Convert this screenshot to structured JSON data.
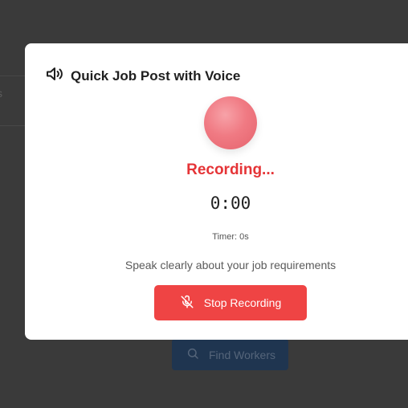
{
  "background": {
    "find_button_label": "Find Workers",
    "tab_fragment": "s"
  },
  "modal": {
    "title": "Quick Job Post with Voice",
    "title_icon": "speaker-icon",
    "recording_indicator": "pulsing-red-orb",
    "status": "Recording...",
    "timer_display": "0:00",
    "timer_label": "Timer: 0s",
    "hint": "Speak clearly about your job requirements",
    "stop_button_label": "Stop Recording",
    "stop_button_icon": "mic-off-icon"
  },
  "colors": {
    "accent_red": "#ef4444",
    "status_red": "#e53437",
    "overlay": "#3a3a3a",
    "find_button": "#1f3550"
  }
}
